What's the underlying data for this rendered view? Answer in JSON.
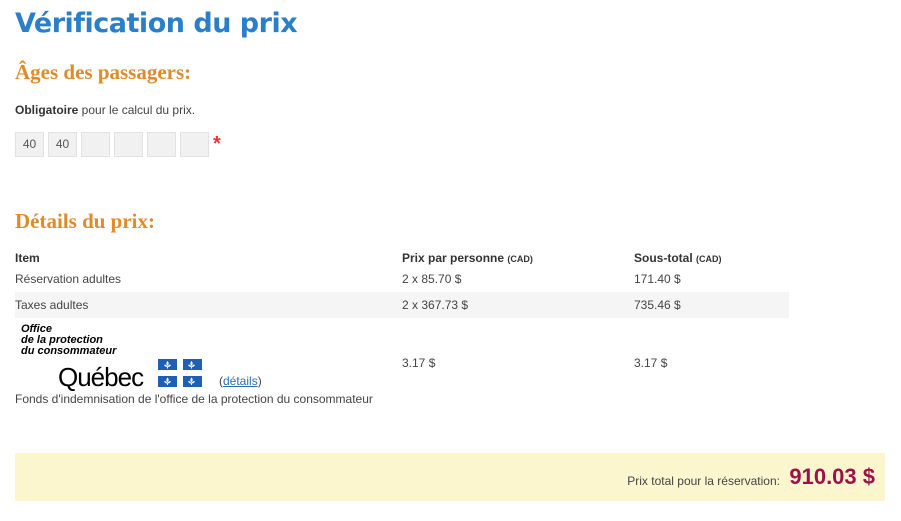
{
  "page": {
    "title": "Vérification du prix"
  },
  "passengers": {
    "heading": "Âges des passagers:",
    "required_bold": "Obligatoire",
    "required_rest": " pour le calcul du prix.",
    "ages": [
      "40",
      "40",
      "",
      "",
      "",
      ""
    ],
    "required_marker": "*"
  },
  "price": {
    "heading": "Détails du prix:",
    "columns": {
      "item": "Item",
      "per_person": "Prix par personne",
      "per_person_unit": "(CAD)",
      "subtotal": "Sous-total",
      "subtotal_unit": "(CAD)"
    },
    "rows": [
      {
        "item": "Réservation adultes",
        "per_person": "2 x 85.70 $",
        "subtotal": "171.40 $"
      },
      {
        "item": "Taxes adultes",
        "per_person": "2 x 367.73 $",
        "subtotal": "735.46 $"
      }
    ],
    "opc": {
      "logo_line1": "Office",
      "logo_line2": "de la protection",
      "logo_line3": "du consommateur",
      "logo_quebec": "Québec",
      "details_link": "détails",
      "details_open": "(",
      "details_close": ")",
      "per_person": "3.17 $",
      "subtotal": "3.17 $",
      "fund_label": "Fonds d'indemnisation de l'office de la protection du consommateur"
    }
  },
  "total": {
    "label": "Prix total pour la réservation:",
    "value": "910.03 $"
  },
  "colors": {
    "title": "#2a7fc9",
    "section_heading": "#e08a2a",
    "total_value": "#9c1148",
    "total_bg": "#fcf6cf",
    "flag_blue": "#1f5fb4"
  }
}
